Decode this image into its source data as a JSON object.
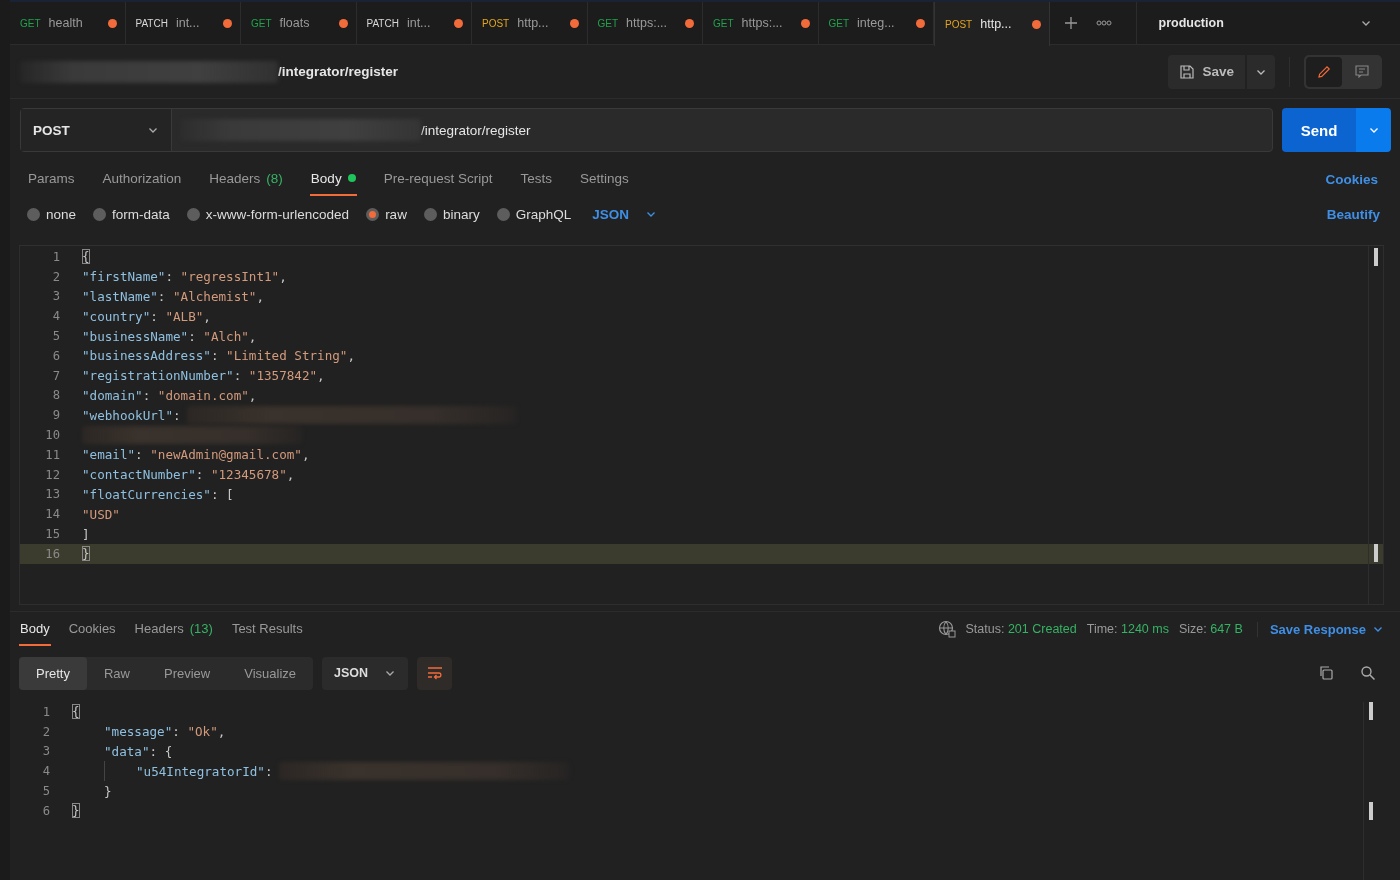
{
  "tabs": [
    {
      "method": "GET",
      "color": "#1fa34a",
      "name": "health",
      "selected": false,
      "unsaved": true
    },
    {
      "method": "PATCH",
      "color": "#d8d8d8",
      "name": "int...",
      "selected": false,
      "unsaved": true
    },
    {
      "method": "GET",
      "color": "#1fa34a",
      "name": "floats",
      "selected": false,
      "unsaved": true
    },
    {
      "method": "PATCH",
      "color": "#d8d8d8",
      "name": "int...",
      "selected": false,
      "unsaved": true
    },
    {
      "method": "POST",
      "color": "#e3a51c",
      "name": "http...",
      "selected": false,
      "unsaved": true
    },
    {
      "method": "GET",
      "color": "#1fa34a",
      "name": "https:...",
      "selected": false,
      "unsaved": true
    },
    {
      "method": "GET",
      "color": "#1fa34a",
      "name": "https:...",
      "selected": false,
      "unsaved": true
    },
    {
      "method": "GET",
      "color": "#1fa34a",
      "name": "integ...",
      "selected": false,
      "unsaved": true
    },
    {
      "method": "POST",
      "color": "#e3a51c",
      "name": "http...",
      "selected": true,
      "unsaved": true
    }
  ],
  "environment": "production",
  "request": {
    "name_path": "/integrator/register",
    "save": "Save",
    "method": "POST",
    "url_path": "/integrator/register",
    "send": "Send"
  },
  "request_tabs": [
    {
      "label": "Params",
      "selected": false
    },
    {
      "label": "Authorization",
      "selected": false
    },
    {
      "label": "Headers",
      "count": "(8)",
      "selected": false
    },
    {
      "label": "Body",
      "selected": true,
      "has_content": true
    },
    {
      "label": "Pre-request Script",
      "selected": false
    },
    {
      "label": "Tests",
      "selected": false
    },
    {
      "label": "Settings",
      "selected": false
    }
  ],
  "cookies_link": "Cookies",
  "body_types": [
    {
      "label": "none",
      "selected": false
    },
    {
      "label": "form-data",
      "selected": false
    },
    {
      "label": "x-www-form-urlencoded",
      "selected": false
    },
    {
      "label": "raw",
      "selected": true
    },
    {
      "label": "binary",
      "selected": false
    },
    {
      "label": "GraphQL",
      "selected": false
    }
  ],
  "body_format": "JSON",
  "beautify": "Beautify",
  "request_body": [
    {
      "number": "1",
      "tokens": [
        {
          "kind": "match",
          "text": "{"
        }
      ]
    },
    {
      "number": "2",
      "tokens": [
        {
          "kind": "key",
          "text": "\"firstName\""
        },
        {
          "kind": "punct",
          "text": ": "
        },
        {
          "kind": "string",
          "text": "\"regressInt1\""
        },
        {
          "kind": "punct",
          "text": ","
        }
      ]
    },
    {
      "number": "3",
      "tokens": [
        {
          "kind": "key",
          "text": "\"lastName\""
        },
        {
          "kind": "punct",
          "text": ": "
        },
        {
          "kind": "string",
          "text": "\"Alchemist\""
        },
        {
          "kind": "punct",
          "text": ","
        }
      ]
    },
    {
      "number": "4",
      "tokens": [
        {
          "kind": "key",
          "text": "\"country\""
        },
        {
          "kind": "punct",
          "text": ": "
        },
        {
          "kind": "string",
          "text": "\"ALB\""
        },
        {
          "kind": "punct",
          "text": ","
        }
      ]
    },
    {
      "number": "5",
      "tokens": [
        {
          "kind": "key",
          "text": "\"businessName\""
        },
        {
          "kind": "punct",
          "text": ": "
        },
        {
          "kind": "string",
          "text": "\"Alch\""
        },
        {
          "kind": "punct",
          "text": ","
        }
      ]
    },
    {
      "number": "6",
      "tokens": [
        {
          "kind": "key",
          "text": "\"businessAddress\""
        },
        {
          "kind": "punct",
          "text": ": "
        },
        {
          "kind": "string",
          "text": "\"Limited String\""
        },
        {
          "kind": "punct",
          "text": ","
        }
      ]
    },
    {
      "number": "7",
      "tokens": [
        {
          "kind": "key",
          "text": "\"registrationNumber\""
        },
        {
          "kind": "punct",
          "text": ": "
        },
        {
          "kind": "string",
          "text": "\"1357842\""
        },
        {
          "kind": "punct",
          "text": ","
        }
      ]
    },
    {
      "number": "8",
      "tokens": [
        {
          "kind": "key",
          "text": "\"domain\""
        },
        {
          "kind": "punct",
          "text": ": "
        },
        {
          "kind": "string",
          "text": "\"domain.com\""
        },
        {
          "kind": "punct",
          "text": ","
        }
      ]
    },
    {
      "number": "9",
      "tokens": [
        {
          "kind": "key",
          "text": "\"webhookUrl\""
        },
        {
          "kind": "punct",
          "text": ":"
        },
        {
          "kind": "redacted"
        }
      ]
    },
    {
      "number": "10",
      "tokens": [
        {
          "kind": "redacted"
        }
      ]
    },
    {
      "number": "11",
      "tokens": [
        {
          "kind": "key",
          "text": "\"email\""
        },
        {
          "kind": "punct",
          "text": ": "
        },
        {
          "kind": "string",
          "text": "\"newAdmin@gmail.com\""
        },
        {
          "kind": "punct",
          "text": ","
        }
      ]
    },
    {
      "number": "12",
      "tokens": [
        {
          "kind": "key",
          "text": "\"contactNumber\""
        },
        {
          "kind": "punct",
          "text": ": "
        },
        {
          "kind": "string",
          "text": "\"12345678\""
        },
        {
          "kind": "punct",
          "text": ","
        }
      ]
    },
    {
      "number": "13",
      "tokens": [
        {
          "kind": "key",
          "text": "\"floatCurrencies\""
        },
        {
          "kind": "punct",
          "text": ": ["
        }
      ]
    },
    {
      "number": "14",
      "tokens": [
        {
          "kind": "string",
          "text": "\"USD\""
        }
      ]
    },
    {
      "number": "15",
      "tokens": [
        {
          "kind": "punct",
          "text": "]"
        }
      ]
    },
    {
      "number": "16",
      "highlighted": true,
      "tokens": [
        {
          "kind": "match",
          "text": "}"
        }
      ]
    }
  ],
  "response_tabs": [
    {
      "label": "Body",
      "selected": true
    },
    {
      "label": "Cookies",
      "selected": false
    },
    {
      "label": "Headers",
      "count": "(13)",
      "selected": false
    },
    {
      "label": "Test Results",
      "selected": false
    }
  ],
  "response_status": [
    {
      "label": "Status:",
      "value": "201 Created"
    },
    {
      "label": "Time:",
      "value": "1240 ms"
    },
    {
      "label": "Size:",
      "value": "647 B"
    }
  ],
  "save_response": "Save Response",
  "view_modes": [
    {
      "label": "Pretty",
      "selected": true
    },
    {
      "label": "Raw",
      "selected": false
    },
    {
      "label": "Preview",
      "selected": false
    },
    {
      "label": "Visualize",
      "selected": false
    }
  ],
  "response_format": "JSON",
  "response_body": [
    {
      "number": "1",
      "tokens": [
        {
          "kind": "match",
          "text": "{"
        }
      ]
    },
    {
      "number": "2",
      "tokens": [
        {
          "kind": "indent"
        },
        {
          "kind": "key",
          "text": "\"message\""
        },
        {
          "kind": "punct",
          "text": ": "
        },
        {
          "kind": "string",
          "text": "\"Ok\""
        },
        {
          "kind": "punct",
          "text": ","
        }
      ]
    },
    {
      "number": "3",
      "tokens": [
        {
          "kind": "indent"
        },
        {
          "kind": "key",
          "text": "\"data\""
        },
        {
          "kind": "punct",
          "text": ": {"
        }
      ]
    },
    {
      "number": "4",
      "tokens": [
        {
          "kind": "indent"
        },
        {
          "kind": "guide"
        },
        {
          "kind": "key",
          "text": "\"u54IntegratorId\""
        },
        {
          "kind": "punct",
          "text": ":"
        },
        {
          "kind": "redacted"
        }
      ]
    },
    {
      "number": "5",
      "tokens": [
        {
          "kind": "indent"
        },
        {
          "kind": "punct",
          "text": "}"
        }
      ]
    },
    {
      "number": "6",
      "tokens": [
        {
          "kind": "match",
          "text": "}"
        }
      ]
    }
  ]
}
